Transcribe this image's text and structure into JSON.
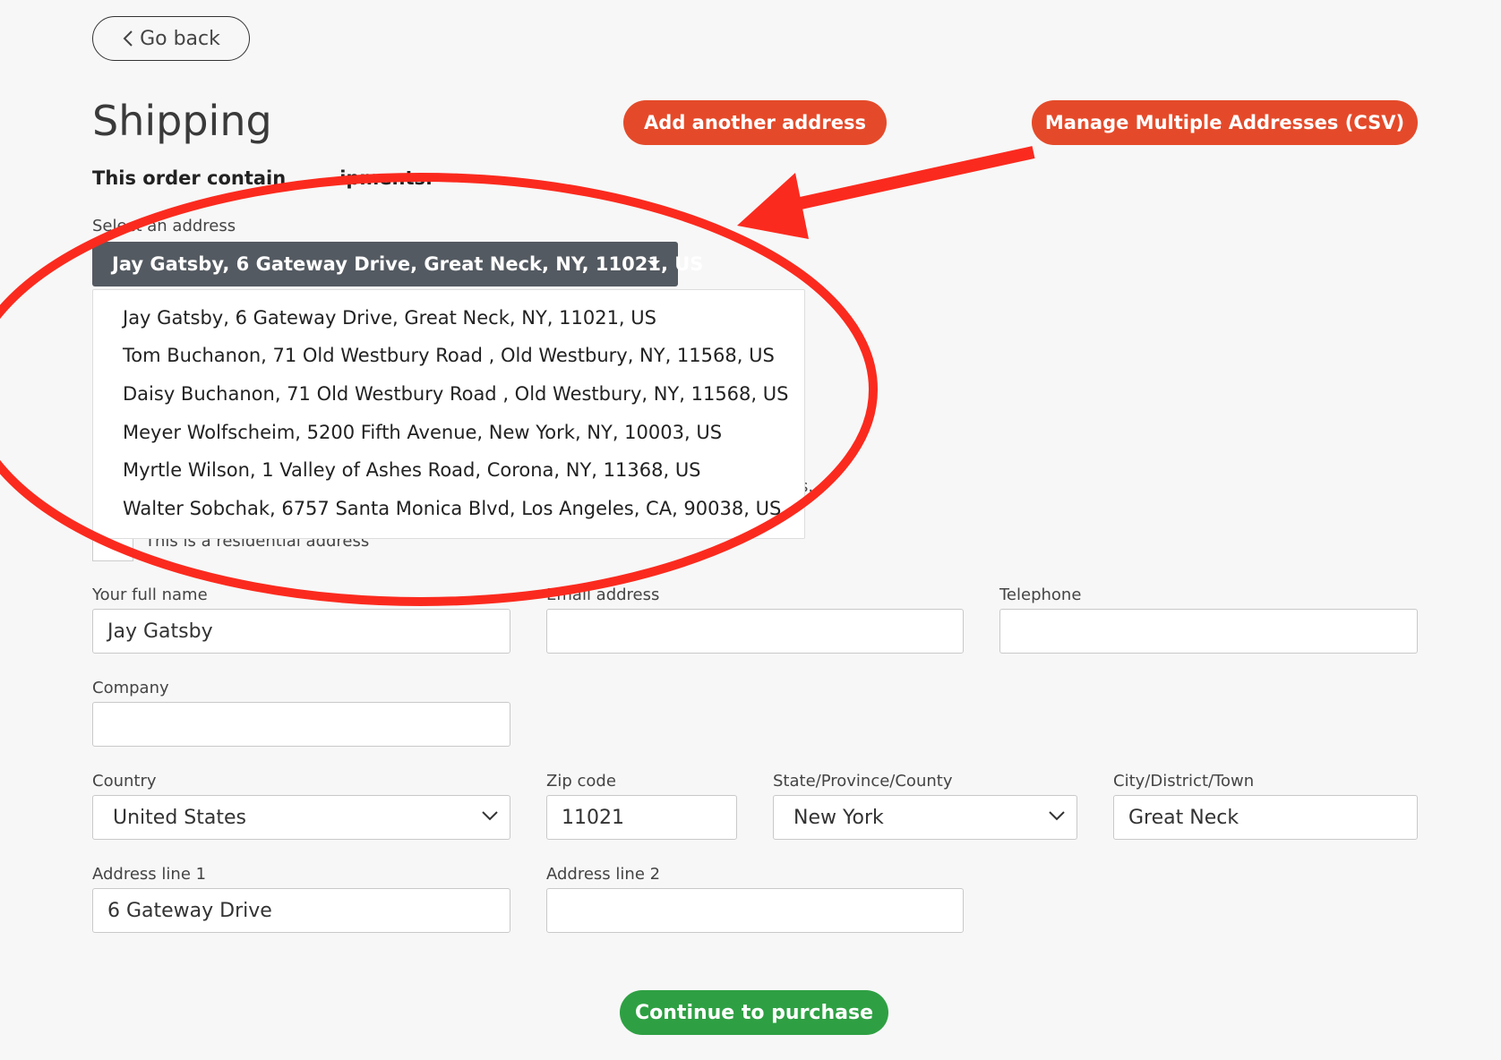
{
  "nav": {
    "back_label": "Go back"
  },
  "page": {
    "title": "Shipping"
  },
  "actions": {
    "add_address_label": "Add another address",
    "manage_multiple_label": "Manage Multiple Addresses (CSV)",
    "continue_label": "Continue to purchase"
  },
  "summary": {
    "text_prefix": "This order contain",
    "text_suffix": "ipments."
  },
  "address_select": {
    "label": "Select an address",
    "selected": "Jay Gatsby, 6 Gateway Drive, Great Neck, NY, 11021, US",
    "options": [
      "Jay Gatsby, 6 Gateway Drive, Great Neck, NY, 11021, US",
      "Tom Buchanon, 71 Old Westbury Road , Old Westbury, NY, 11568, US",
      "Daisy Buchanon, 71 Old Westbury Road , Old Westbury, NY, 11568, US",
      "Meyer Wolfscheim, 5200 Fifth Avenue, New York, NY, 10003, US",
      "Myrtle Wilson, 1 Valley of Ashes Road, Corona, NY, 11368, US",
      "Walter Sobchak, 6757 Santa Monica Blvd, Los Angeles, CA, 90038, US"
    ]
  },
  "residential": {
    "label": "This is a residential address"
  },
  "form": {
    "full_name": {
      "label": "Your full name",
      "value": "Jay Gatsby"
    },
    "email": {
      "label": "Email address",
      "value": ""
    },
    "telephone": {
      "label": "Telephone",
      "value": ""
    },
    "company": {
      "label": "Company",
      "value": ""
    },
    "country": {
      "label": "Country",
      "value": "United States"
    },
    "zip": {
      "label": "Zip code",
      "value": "11021"
    },
    "state": {
      "label": "State/Province/County",
      "value": "New York"
    },
    "city": {
      "label": "City/District/Town",
      "value": "Great Neck"
    },
    "address1": {
      "label": "Address line 1",
      "value": "6 Gateway Drive"
    },
    "address2": {
      "label": "Address line 2",
      "value": ""
    }
  },
  "colors": {
    "accent_orange": "#e44a2a",
    "accent_green": "#2ea043",
    "select_dark": "#545a61",
    "annotation_red": "#fb2a1e"
  }
}
